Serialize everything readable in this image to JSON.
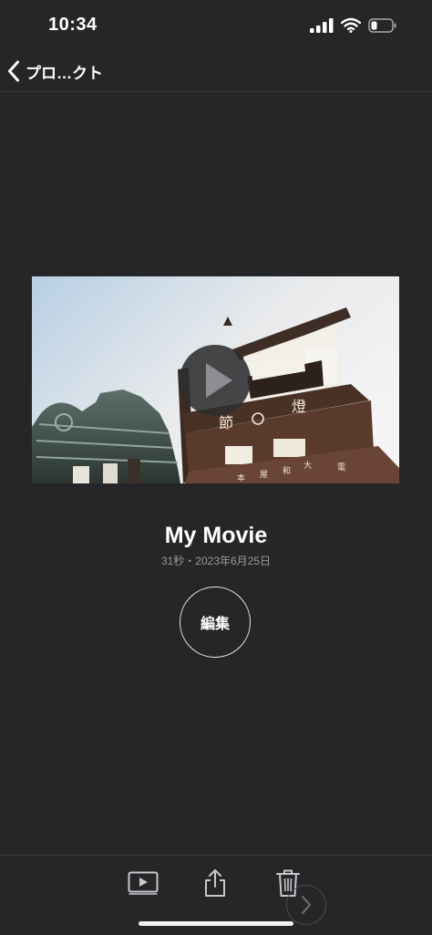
{
  "status_bar": {
    "time": "10:34"
  },
  "nav": {
    "back_label": "プロ…クト"
  },
  "video": {
    "title": "My Movie",
    "subtitle": "31秒・2023年6月25日",
    "edit_label": "編集"
  }
}
